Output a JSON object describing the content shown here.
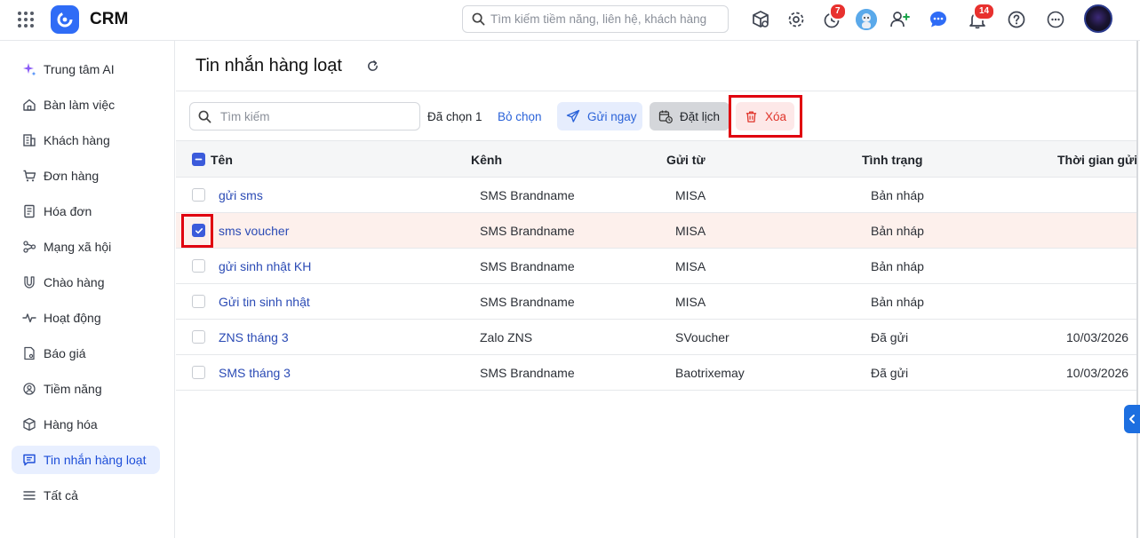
{
  "app": {
    "title": "CRM"
  },
  "search": {
    "placeholder": "Tìm kiếm tiềm năng, liên hệ, khách hàng"
  },
  "topbar": {
    "timer_badge": "7",
    "notification_badge": "14",
    "icons": [
      "box-search-icon",
      "gear-icon",
      "timer-icon",
      "bot-avatar",
      "add-user-icon",
      "chat-icon",
      "bell-icon",
      "help-icon",
      "more-icon",
      "user-avatar"
    ]
  },
  "sidebar": {
    "items": [
      {
        "label": "Trung tâm AI",
        "icon": "sparkle-icon"
      },
      {
        "label": "Bàn làm việc",
        "icon": "home-icon"
      },
      {
        "label": "Khách hàng",
        "icon": "building-icon"
      },
      {
        "label": "Đơn hàng",
        "icon": "cart-icon"
      },
      {
        "label": "Hóa đơn",
        "icon": "invoice-icon"
      },
      {
        "label": "Mạng xã hội",
        "icon": "share-icon"
      },
      {
        "label": "Chào hàng",
        "icon": "magnet-icon"
      },
      {
        "label": "Hoạt động",
        "icon": "pulse-icon"
      },
      {
        "label": "Báo giá",
        "icon": "quote-icon"
      },
      {
        "label": "Tiềm năng",
        "icon": "target-icon"
      },
      {
        "label": "Hàng hóa",
        "icon": "package-icon"
      },
      {
        "label": "Tin nhắn hàng loạt",
        "icon": "message-icon",
        "active": true
      },
      {
        "label": "Tất cả",
        "icon": "menu-icon"
      }
    ]
  },
  "page": {
    "title": "Tin nhắn hàng loạt"
  },
  "toolbar": {
    "search_placeholder": "Tìm kiếm",
    "selected_text": "Đã chọn 1",
    "deselect_label": "Bỏ chọn",
    "send_now_label": "Gửi ngay",
    "schedule_label": "Đặt lịch",
    "delete_label": "Xóa"
  },
  "table": {
    "headers": {
      "name": "Tên",
      "channel": "Kênh",
      "sender": "Gửi từ",
      "status": "Tình trạng",
      "sent_time": "Thời gian gửi"
    },
    "rows": [
      {
        "name": "gửi sms",
        "channel": "SMS Brandname",
        "sender": "MISA",
        "status": "Bản nháp",
        "sent_time": "",
        "checked": false
      },
      {
        "name": "sms voucher",
        "channel": "SMS Brandname",
        "sender": "MISA",
        "status": "Bản nháp",
        "sent_time": "",
        "checked": true
      },
      {
        "name": "gửi sinh nhật KH",
        "channel": "SMS Brandname",
        "sender": "MISA",
        "status": "Bản nháp",
        "sent_time": "",
        "checked": false
      },
      {
        "name": "Gửi tin sinh nhật",
        "channel": "SMS Brandname",
        "sender": "MISA",
        "status": "Bản nháp",
        "sent_time": "",
        "checked": false
      },
      {
        "name": "ZNS tháng 3",
        "channel": "Zalo ZNS",
        "sender": "SVoucher",
        "status": "Đã gửi",
        "sent_time": "10/03/2026",
        "checked": false
      },
      {
        "name": "SMS tháng 3",
        "channel": "SMS Brandname",
        "sender": "Baotrixemay",
        "status": "Đã gửi",
        "sent_time": "10/03/2026",
        "checked": false
      }
    ]
  },
  "colors": {
    "accent": "#2b63d9",
    "brand": "#2f6cf6",
    "danger": "#e0352b",
    "highlight": "#e0000f"
  }
}
